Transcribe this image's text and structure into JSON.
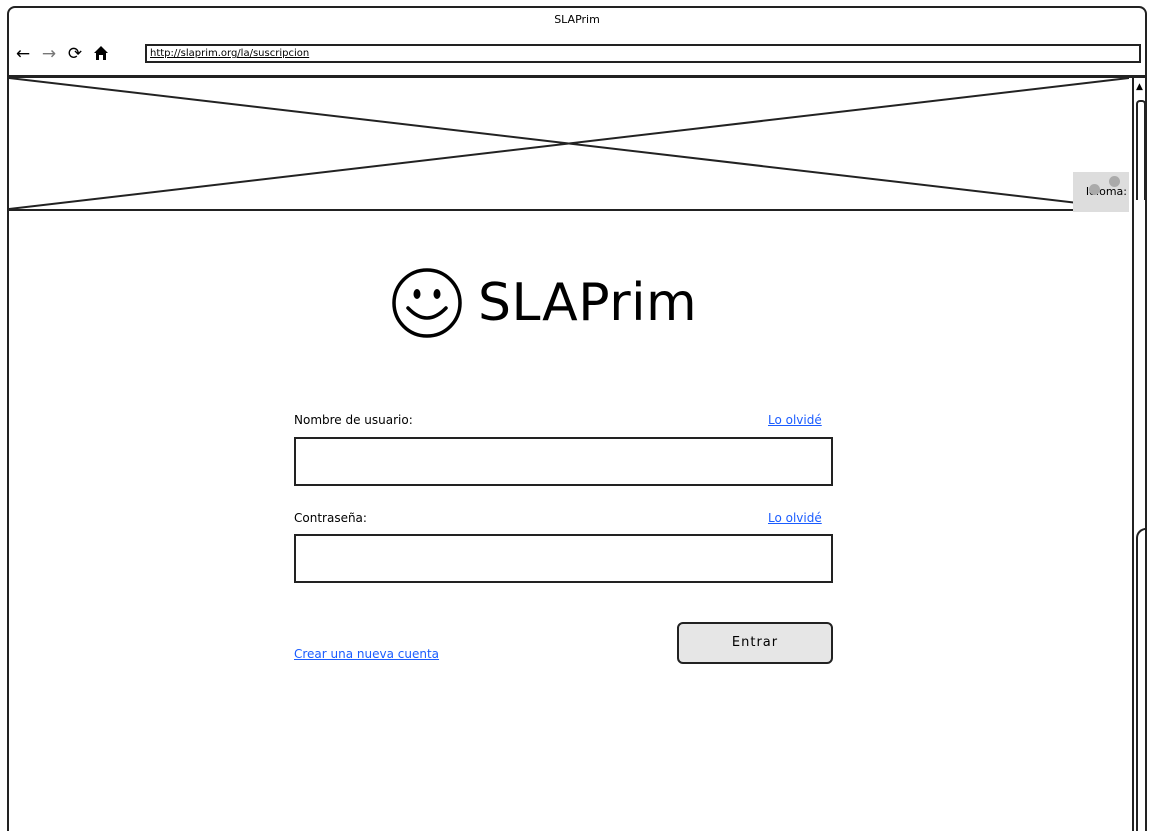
{
  "window": {
    "title": "SLAPrim"
  },
  "navbar": {
    "icons": {
      "back": "back-arrow-icon",
      "forward": "forward-arrow-icon",
      "reload": "reload-icon",
      "home": "home-icon"
    },
    "url": "http://slaprim.org/la/suscripcion"
  },
  "header": {
    "banner": "image-placeholder",
    "language_label": "Idioma:"
  },
  "logo": {
    "icon": "smiley-icon",
    "text": "SLAPrim"
  },
  "form": {
    "username_label": "Nombre de usuario:",
    "username_forgot": "Lo olvidé",
    "username_value": "",
    "password_label": "Contraseña:",
    "password_forgot": "Lo olvidé",
    "password_value": "",
    "create_account": "Crear una nueva cuenta",
    "submit_label": "Entrar"
  },
  "colors": {
    "link": "#1a5cff",
    "button_bg": "#e6e6e6",
    "border": "#222222"
  }
}
